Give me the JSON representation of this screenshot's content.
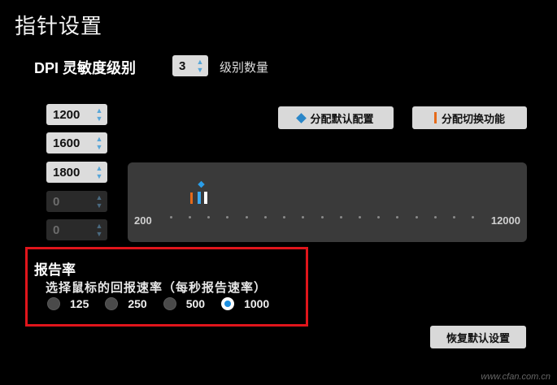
{
  "title": "指针设置",
  "dpi": {
    "label": "DPI 灵敏度级别",
    "level_count": "3",
    "level_label": "级别数量",
    "values": [
      "1200",
      "1600",
      "1800",
      "0",
      "0"
    ]
  },
  "buttons": {
    "assign_default": "分配默认配置",
    "assign_switch": "分配切换功能",
    "restore": "恢复默认设置"
  },
  "slider": {
    "min_label": "200",
    "max_label": "12000"
  },
  "report_rate": {
    "title": "报告率",
    "subtitle": "选择鼠标的回报速率（每秒报告速率）",
    "options": [
      "125",
      "250",
      "500",
      "1000"
    ],
    "selected": "1000"
  },
  "watermark": "www.cfan.com.cn",
  "colors": {
    "accent_blue": "#1d8fe0",
    "marker_orange": "#e56a1a",
    "highlight_red": "#e0151b"
  }
}
